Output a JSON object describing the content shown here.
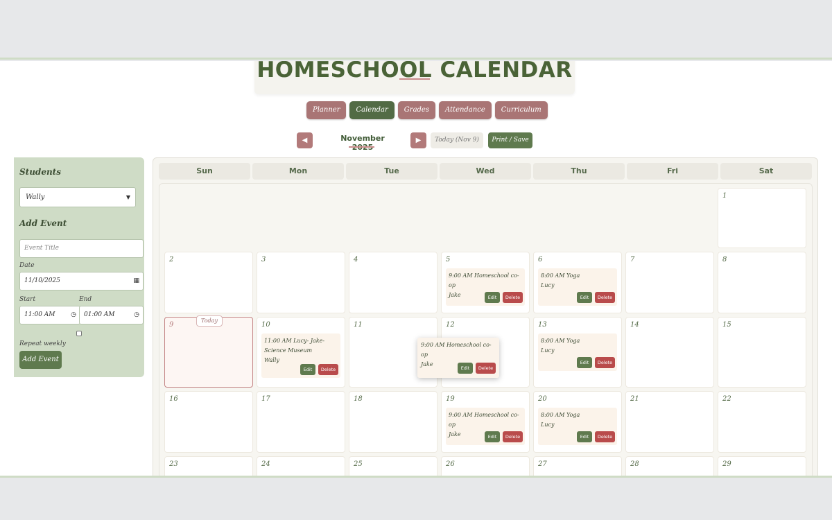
{
  "title": "HOMESCHOOL CALENDAR",
  "nav": [
    {
      "label": "Planner",
      "active": false
    },
    {
      "label": "Calendar",
      "active": true
    },
    {
      "label": "Grades",
      "active": false
    },
    {
      "label": "Attendance",
      "active": false
    },
    {
      "label": "Curriculum",
      "active": false
    }
  ],
  "month": {
    "label": "November 2025",
    "prev_icon": "◀",
    "next_icon": "▶",
    "today_label": "Today (Nov 9)",
    "print_label": "Print / Save"
  },
  "sidebar": {
    "students_heading": "Students",
    "student_selected": "Wally",
    "add_event_heading": "Add Event",
    "event_title_placeholder": "Event Title",
    "date_label": "Date",
    "date_value": "11/10/2025",
    "start_label": "Start",
    "start_value": "11:00 AM",
    "end_label": "End",
    "end_value": "01:00 AM",
    "repeat_label": "Repeat weekly",
    "repeat_checked": false,
    "add_button": "Add Event"
  },
  "days_of_week": [
    "Sun",
    "Mon",
    "Tue",
    "Wed",
    "Thu",
    "Fri",
    "Sat"
  ],
  "today_tag": "Today",
  "event_edit_label": "Edit",
  "event_delete_label": "Delete",
  "weeks": [
    [
      null,
      null,
      null,
      null,
      null,
      null,
      "1"
    ],
    [
      "2",
      "3",
      "4",
      "5",
      "6",
      "7",
      "8"
    ],
    [
      "9",
      "10",
      "11",
      "12",
      "13",
      "14",
      "15"
    ],
    [
      "16",
      "17",
      "18",
      "19",
      "20",
      "21",
      "22"
    ],
    [
      "23",
      "24",
      "25",
      "26",
      "27",
      "28",
      "29"
    ]
  ],
  "events": [
    {
      "day": "5",
      "time": "9:00 AM",
      "title": "Homeschool co-op",
      "student": "Jake"
    },
    {
      "day": "6",
      "time": "8:00 AM",
      "title": "Yoga",
      "student": "Lucy"
    },
    {
      "day": "10",
      "time": "11:00 AM",
      "title": "Lucy- Jake- Science Museum",
      "student": "Wally"
    },
    {
      "day": "13",
      "time": "8:00 AM",
      "title": "Yoga",
      "student": "Lucy"
    },
    {
      "day": "19",
      "time": "9:00 AM",
      "title": "Homeschool co-op",
      "student": "Jake"
    },
    {
      "day": "20",
      "time": "8:00 AM",
      "title": "Yoga",
      "student": "Lucy"
    }
  ],
  "dragging_event": {
    "time": "9:00 AM",
    "title": "Homeschool co-op",
    "student": "Jake"
  },
  "colors": {
    "primary_green": "#526b45",
    "rose": "#a97575",
    "delete_red": "#b94b4b",
    "sidebar_bg": "#cfdcc6"
  }
}
